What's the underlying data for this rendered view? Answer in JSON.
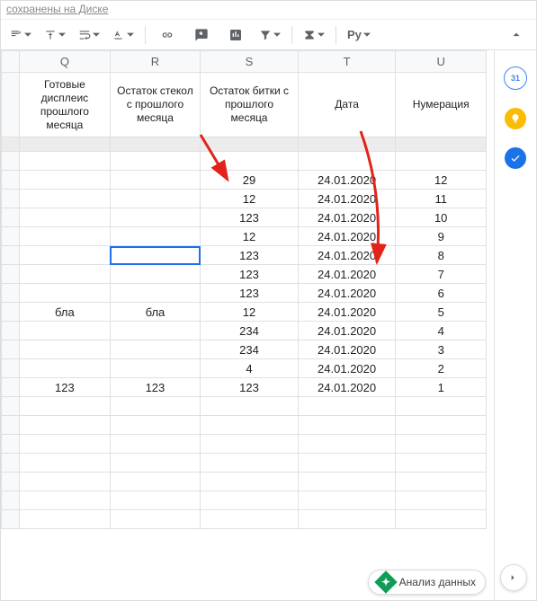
{
  "status_text": "сохранены на Диске",
  "toolbar": {
    "functions_label": "Py"
  },
  "columns": [
    "Q",
    "R",
    "S",
    "T",
    "U"
  ],
  "headers": {
    "q": "Готовые дисплеис прошлого месяца",
    "r": "Остаток стекол с прошлого месяца",
    "s": "Остаток битки с прошлого месяца",
    "t": "Дата",
    "u": "Нумерация"
  },
  "rows": [
    {
      "q": "",
      "r": "",
      "s": "",
      "t": "",
      "u": ""
    },
    {
      "q": "",
      "r": "",
      "s": "29",
      "t": "24.01.2020",
      "u": "12"
    },
    {
      "q": "",
      "r": "",
      "s": "12",
      "t": "24.01.2020",
      "u": "11"
    },
    {
      "q": "",
      "r": "",
      "s": "123",
      "t": "24.01.2020",
      "u": "10"
    },
    {
      "q": "",
      "r": "",
      "s": "12",
      "t": "24.01.2020",
      "u": "9"
    },
    {
      "q": "",
      "r": "",
      "s": "123",
      "t": "24.01.2020",
      "u": "8"
    },
    {
      "q": "",
      "r": "",
      "s": "123",
      "t": "24.01.2020",
      "u": "7"
    },
    {
      "q": "",
      "r": "",
      "s": "123",
      "t": "24.01.2020",
      "u": "6"
    },
    {
      "q": "бла",
      "r": "бла",
      "s": "12",
      "t": "24.01.2020",
      "u": "5"
    },
    {
      "q": "",
      "r": "",
      "s": "234",
      "t": "24.01.2020",
      "u": "4"
    },
    {
      "q": "",
      "r": "",
      "s": "234",
      "t": "24.01.2020",
      "u": "3"
    },
    {
      "q": "",
      "r": "",
      "s": "4",
      "t": "24.01.2020",
      "u": "2"
    },
    {
      "q": "123",
      "r": "123",
      "s": "123",
      "t": "24.01.2020",
      "u": "1"
    }
  ],
  "selected_cell": {
    "row_index": 5,
    "col": "r"
  },
  "explore_label": "Анализ данных",
  "side": {
    "calendar": "31"
  }
}
